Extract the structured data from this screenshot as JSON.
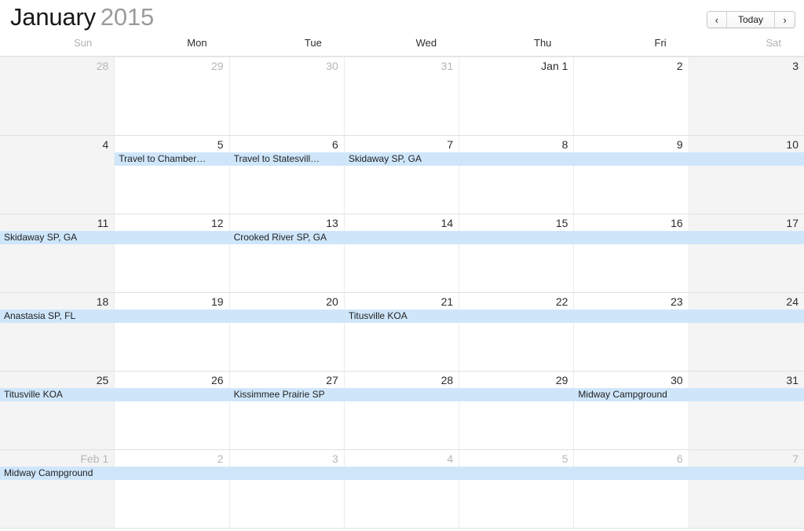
{
  "header": {
    "month": "January",
    "year": "2015",
    "nav": {
      "prev_label": "‹",
      "today_label": "Today",
      "next_label": "›"
    }
  },
  "weekdays": [
    {
      "label": "Sun",
      "dim": true
    },
    {
      "label": "Mon",
      "dim": false
    },
    {
      "label": "Tue",
      "dim": false
    },
    {
      "label": "Wed",
      "dim": false
    },
    {
      "label": "Thu",
      "dim": false
    },
    {
      "label": "Fri",
      "dim": false
    },
    {
      "label": "Sat",
      "dim": true
    }
  ],
  "colors": {
    "event_background": "#cfe6fa",
    "event_text": "#1f1f21",
    "weekend_background": "#f4f4f4",
    "grid_line": "#ececec",
    "dim_text": "#b6b6b8"
  },
  "weeks": [
    {
      "days": [
        {
          "label": "28",
          "other_month": true,
          "weekend": true
        },
        {
          "label": "29",
          "other_month": true,
          "weekend": false
        },
        {
          "label": "30",
          "other_month": true,
          "weekend": false
        },
        {
          "label": "31",
          "other_month": true,
          "weekend": false
        },
        {
          "label": "Jan 1",
          "other_month": false,
          "weekend": false
        },
        {
          "label": "2",
          "other_month": false,
          "weekend": false
        },
        {
          "label": "3",
          "other_month": false,
          "weekend": true
        }
      ],
      "events": []
    },
    {
      "days": [
        {
          "label": "4",
          "other_month": false,
          "weekend": true
        },
        {
          "label": "5",
          "other_month": false,
          "weekend": false
        },
        {
          "label": "6",
          "other_month": false,
          "weekend": false
        },
        {
          "label": "7",
          "other_month": false,
          "weekend": false
        },
        {
          "label": "8",
          "other_month": false,
          "weekend": false
        },
        {
          "label": "9",
          "other_month": false,
          "weekend": false
        },
        {
          "label": "10",
          "other_month": false,
          "weekend": true
        }
      ],
      "events": [
        {
          "title": "Travel to Chamber…",
          "start": 1,
          "span": 1,
          "row": 0
        },
        {
          "title": "Travel to Statesvill…",
          "start": 2,
          "span": 1,
          "row": 0
        },
        {
          "title": "Skidaway SP, GA",
          "start": 3,
          "span": 4,
          "row": 0
        }
      ]
    },
    {
      "days": [
        {
          "label": "11",
          "other_month": false,
          "weekend": true
        },
        {
          "label": "12",
          "other_month": false,
          "weekend": false
        },
        {
          "label": "13",
          "other_month": false,
          "weekend": false
        },
        {
          "label": "14",
          "other_month": false,
          "weekend": false
        },
        {
          "label": "15",
          "other_month": false,
          "weekend": false
        },
        {
          "label": "16",
          "other_month": false,
          "weekend": false
        },
        {
          "label": "17",
          "other_month": false,
          "weekend": true
        }
      ],
      "events": [
        {
          "title": "Skidaway SP, GA",
          "start": 0,
          "span": 2,
          "row": 0
        },
        {
          "title": "Crooked River SP, GA",
          "start": 2,
          "span": 5,
          "row": 0
        }
      ]
    },
    {
      "days": [
        {
          "label": "18",
          "other_month": false,
          "weekend": true
        },
        {
          "label": "19",
          "other_month": false,
          "weekend": false
        },
        {
          "label": "20",
          "other_month": false,
          "weekend": false
        },
        {
          "label": "21",
          "other_month": false,
          "weekend": false
        },
        {
          "label": "22",
          "other_month": false,
          "weekend": false
        },
        {
          "label": "23",
          "other_month": false,
          "weekend": false
        },
        {
          "label": "24",
          "other_month": false,
          "weekend": true
        }
      ],
      "events": [
        {
          "title": "Anastasia SP, FL",
          "start": 0,
          "span": 3,
          "row": 0
        },
        {
          "title": "Titusville KOA",
          "start": 3,
          "span": 4,
          "row": 0
        }
      ]
    },
    {
      "days": [
        {
          "label": "25",
          "other_month": false,
          "weekend": true
        },
        {
          "label": "26",
          "other_month": false,
          "weekend": false
        },
        {
          "label": "27",
          "other_month": false,
          "weekend": false
        },
        {
          "label": "28",
          "other_month": false,
          "weekend": false
        },
        {
          "label": "29",
          "other_month": false,
          "weekend": false
        },
        {
          "label": "30",
          "other_month": false,
          "weekend": false
        },
        {
          "label": "31",
          "other_month": false,
          "weekend": true
        }
      ],
      "events": [
        {
          "title": "Titusville KOA",
          "start": 0,
          "span": 2,
          "row": 0
        },
        {
          "title": "Kissimmee Prairie SP",
          "start": 2,
          "span": 3,
          "row": 0
        },
        {
          "title": "Midway Campground",
          "start": 5,
          "span": 2,
          "row": 0
        }
      ]
    },
    {
      "days": [
        {
          "label": "Feb 1",
          "other_month": true,
          "weekend": true
        },
        {
          "label": "2",
          "other_month": true,
          "weekend": false
        },
        {
          "label": "3",
          "other_month": true,
          "weekend": false
        },
        {
          "label": "4",
          "other_month": true,
          "weekend": false
        },
        {
          "label": "5",
          "other_month": true,
          "weekend": false
        },
        {
          "label": "6",
          "other_month": true,
          "weekend": false
        },
        {
          "label": "7",
          "other_month": true,
          "weekend": true
        }
      ],
      "events": [
        {
          "title": "Midway Campground",
          "start": 0,
          "span": 7,
          "row": 0
        }
      ]
    }
  ]
}
